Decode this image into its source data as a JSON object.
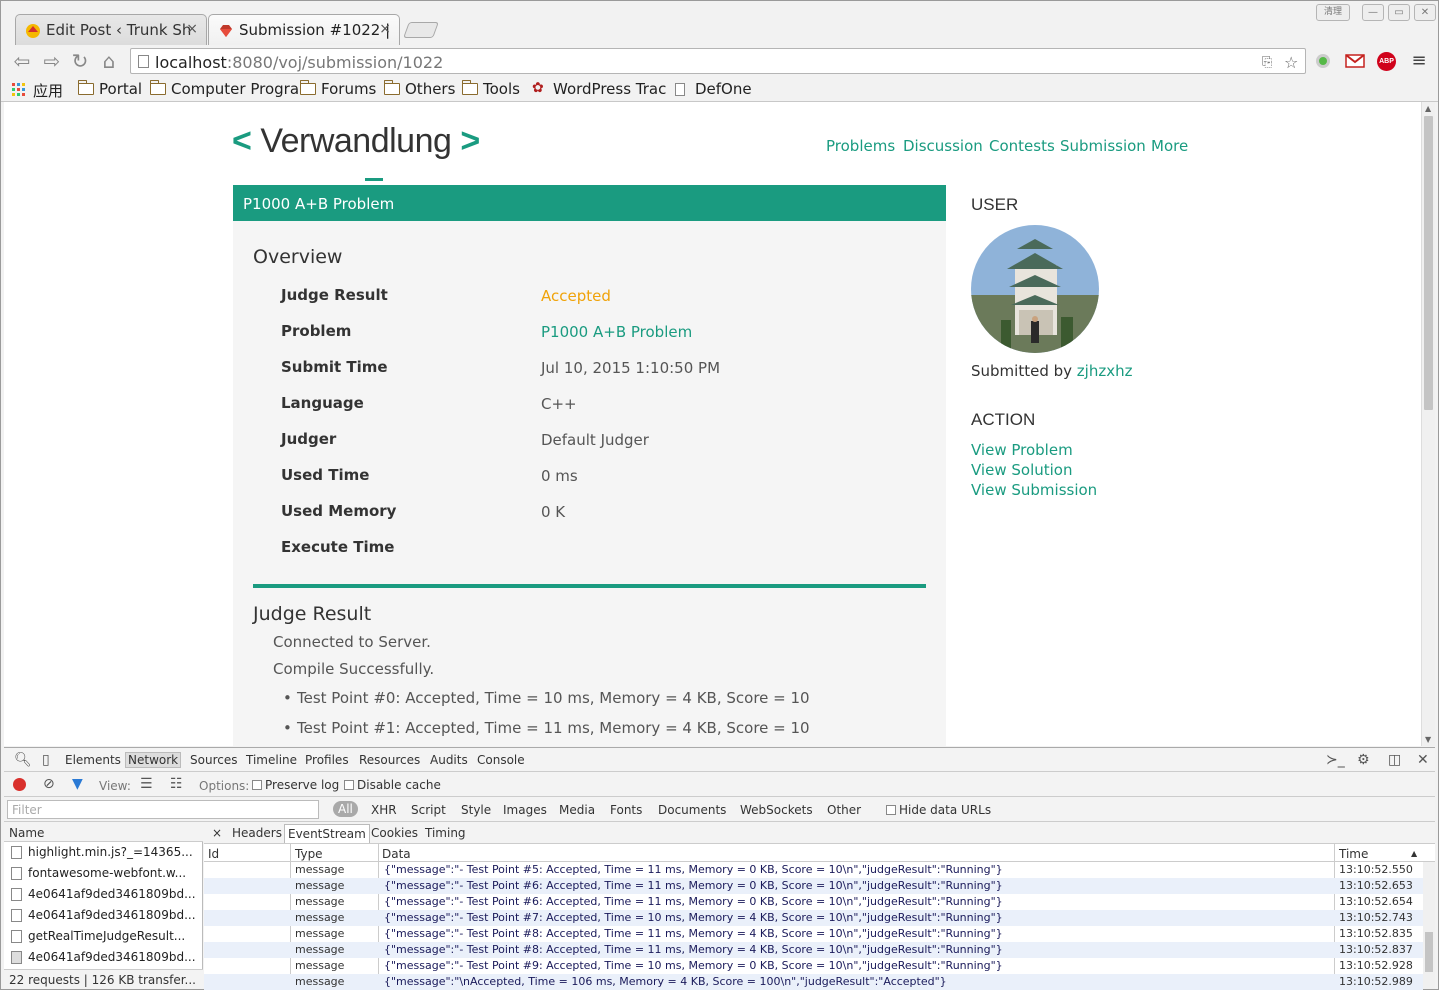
{
  "browser": {
    "tabs": [
      {
        "title": "Edit Post ‹ Trunk Sh",
        "active": false
      },
      {
        "title": "Submission #1022 |",
        "active": true
      }
    ],
    "tab_close": "×",
    "url_host": "localhost",
    "url_path": ":8080/voj/submission/1022",
    "window_badge": "清理",
    "bookmarks": [
      {
        "label": "应用",
        "icon": "apps-icon"
      },
      {
        "label": "Portal",
        "icon": "folder-icon"
      },
      {
        "label": "Computer Progra",
        "icon": "folder-icon"
      },
      {
        "label": "Forums",
        "icon": "folder-icon"
      },
      {
        "label": "Others",
        "icon": "folder-icon"
      },
      {
        "label": "Tools",
        "icon": "folder-icon"
      },
      {
        "label": "WordPress Trac",
        "icon": "paw-icon"
      },
      {
        "label": "DefOne",
        "icon": "page-icon"
      }
    ],
    "extensions": {
      "abp": "ABP"
    }
  },
  "site": {
    "logo_open": "<",
    "logo_text": "Verwandlung",
    "logo_close": ">",
    "nav": [
      "Problems",
      "Discussion",
      "Contests",
      "Submission",
      "More"
    ],
    "accent": "#1a9b80"
  },
  "submission": {
    "panel_title": "P1000 A+B Problem",
    "overview_title": "Overview",
    "rows": [
      {
        "label": "Judge Result",
        "value": "Accepted"
      },
      {
        "label": "Problem",
        "value": "P1000 A+B Problem"
      },
      {
        "label": "Submit Time",
        "value": "Jul 10, 2015 1:10:50 PM"
      },
      {
        "label": "Language",
        "value": "C++"
      },
      {
        "label": "Judger",
        "value": "Default Judger"
      },
      {
        "label": "Used Time",
        "value": "0 ms"
      },
      {
        "label": "Used Memory",
        "value": "0 K"
      },
      {
        "label": "Execute Time",
        "value": ""
      }
    ],
    "accepted_color": "#f0a30a",
    "judge_title": "Judge Result",
    "log": [
      "Connected to Server.",
      "Compile Successfully."
    ],
    "test_points": [
      "Test Point #0: Accepted, Time = 10 ms, Memory = 4 KB, Score = 10",
      "Test Point #1: Accepted, Time = 11 ms, Memory = 4 KB, Score = 10"
    ]
  },
  "sidebar": {
    "user_heading": "USER",
    "submitted_by": "Submitted by",
    "username": "zjhzxhz",
    "action_heading": "ACTION",
    "actions": [
      "View Problem",
      "View Solution",
      "View Submission"
    ]
  },
  "devtools": {
    "tabs": [
      "Elements",
      "Network",
      "Sources",
      "Timeline",
      "Profiles",
      "Resources",
      "Audits",
      "Console"
    ],
    "view_label": "View:",
    "options_label": "Options:",
    "preserve_log": "Preserve log",
    "disable_cache": "Disable cache",
    "filter_placeholder": "Filter",
    "types": [
      "All",
      "XHR",
      "Script",
      "Style",
      "Images",
      "Media",
      "Fonts",
      "Documents",
      "WebSockets",
      "Other"
    ],
    "hide_data_urls": "Hide data URLs",
    "name_header": "Name",
    "requests": [
      "highlight.min.js?_=14365...",
      "fontawesome-webfont.w...",
      "4e0641af9ded3461809bd...",
      "4e0641af9ded3461809bd...",
      "getRealTimeJudgeResult...",
      "4e0641af9ded3461809bd..."
    ],
    "summary": "22 requests  |  126 KB transfer...",
    "detail_tabs": [
      "Headers",
      "EventStream",
      "Cookies",
      "Timing"
    ],
    "close": "×",
    "columns": {
      "id": "Id",
      "type": "Type",
      "data": "Data",
      "time": "Time"
    },
    "events": [
      {
        "type": "message",
        "data": "{\"message\":\"- Test Point #5: Accepted, Time = 11 ms, Memory = 0 KB, Score = 10\\n\",\"judgeResult\":\"Running\"}",
        "time": "13:10:52.550"
      },
      {
        "type": "message",
        "data": "{\"message\":\"- Test Point #6: Accepted, Time = 11 ms, Memory = 0 KB, Score = 10\\n\",\"judgeResult\":\"Running\"}",
        "time": "13:10:52.653"
      },
      {
        "type": "message",
        "data": "{\"message\":\"- Test Point #6: Accepted, Time = 11 ms, Memory = 0 KB, Score = 10\\n\",\"judgeResult\":\"Running\"}",
        "time": "13:10:52.654"
      },
      {
        "type": "message",
        "data": "{\"message\":\"- Test Point #7: Accepted, Time = 10 ms, Memory = 4 KB, Score = 10\\n\",\"judgeResult\":\"Running\"}",
        "time": "13:10:52.743"
      },
      {
        "type": "message",
        "data": "{\"message\":\"- Test Point #8: Accepted, Time = 11 ms, Memory = 4 KB, Score = 10\\n\",\"judgeResult\":\"Running\"}",
        "time": "13:10:52.835"
      },
      {
        "type": "message",
        "data": "{\"message\":\"- Test Point #8: Accepted, Time = 11 ms, Memory = 4 KB, Score = 10\\n\",\"judgeResult\":\"Running\"}",
        "time": "13:10:52.837"
      },
      {
        "type": "message",
        "data": "{\"message\":\"- Test Point #9: Accepted, Time = 10 ms, Memory = 0 KB, Score = 10\\n\",\"judgeResult\":\"Running\"}",
        "time": "13:10:52.928"
      },
      {
        "type": "message",
        "data": "{\"message\":\"\\nAccepted, Time = 106 ms, Memory = 4 KB, Score = 100\\n\",\"judgeResult\":\"Accepted\"}",
        "time": "13:10:52.989"
      }
    ]
  }
}
